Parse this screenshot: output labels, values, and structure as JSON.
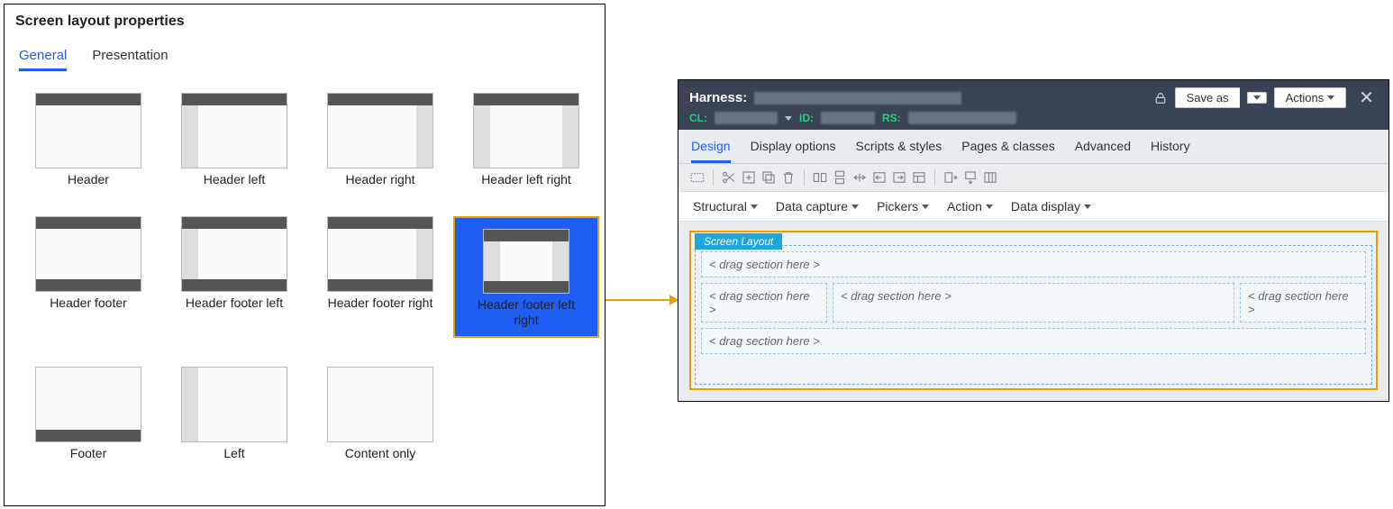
{
  "props": {
    "title": "Screen layout properties",
    "tabs": [
      "General",
      "Presentation"
    ],
    "active_tab": 0,
    "options": [
      {
        "id": "header",
        "label": "Header",
        "top": true,
        "bot": false,
        "left": false,
        "right": false
      },
      {
        "id": "header_left",
        "label": "Header left",
        "top": true,
        "bot": false,
        "left": true,
        "right": false
      },
      {
        "id": "header_right",
        "label": "Header right",
        "top": true,
        "bot": false,
        "left": false,
        "right": true
      },
      {
        "id": "header_left_right",
        "label": "Header left right",
        "top": true,
        "bot": false,
        "left": true,
        "right": true
      },
      {
        "id": "header_footer",
        "label": "Header footer",
        "top": true,
        "bot": true,
        "left": false,
        "right": false
      },
      {
        "id": "header_footer_left",
        "label": "Header footer left",
        "top": true,
        "bot": true,
        "left": true,
        "right": false
      },
      {
        "id": "header_footer_right",
        "label": "Header footer right",
        "top": true,
        "bot": true,
        "left": false,
        "right": true
      },
      {
        "id": "header_footer_lr",
        "label": "Header footer left right",
        "top": true,
        "bot": true,
        "left": true,
        "right": true,
        "selected": true
      },
      {
        "id": "footer",
        "label": "Footer",
        "top": false,
        "bot": true,
        "left": false,
        "right": false
      },
      {
        "id": "left",
        "label": "Left",
        "top": false,
        "bot": false,
        "left": true,
        "right": false
      },
      {
        "id": "content",
        "label": "Content only",
        "top": false,
        "bot": false,
        "left": false,
        "right": false
      }
    ]
  },
  "editor": {
    "harness_label": "Harness:",
    "cl_label": "CL:",
    "id_label": "ID:",
    "rs_label": "RS:",
    "save_as": "Save as",
    "actions": "Actions",
    "tabs": [
      "Design",
      "Display options",
      "Scripts & styles",
      "Pages & classes",
      "Advanced",
      "History"
    ],
    "categories": [
      "Structural",
      "Data capture",
      "Pickers",
      "Action",
      "Data display"
    ],
    "screen_layout_badge": "Screen Layout",
    "dz": "< drag section here >"
  }
}
